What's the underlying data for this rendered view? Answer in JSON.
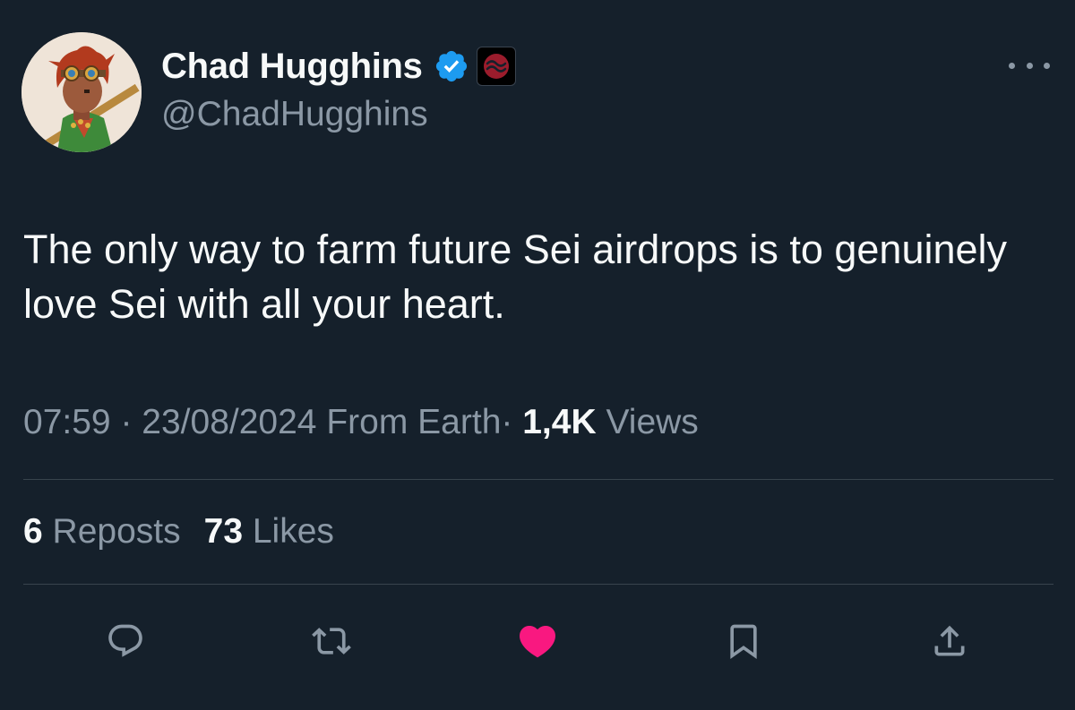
{
  "user": {
    "display_name": "Chad Hugghins",
    "handle": "@ChadHugghins",
    "verified": true
  },
  "tweet": {
    "text": "The only way to farm future Sei airdrops is to genuinely love Sei with all your heart.",
    "time": "07:59",
    "separator": "·",
    "date": "23/08/2024",
    "source": "From Earth",
    "views_count": "1,4K",
    "views_label": "Views"
  },
  "stats": {
    "reposts_count": "6",
    "reposts_label": "Reposts",
    "likes_count": "73",
    "likes_label": "Likes"
  },
  "actions": [
    {
      "icon": "reply-icon",
      "active": false
    },
    {
      "icon": "repost-icon",
      "active": false
    },
    {
      "icon": "heart-icon",
      "active": true
    },
    {
      "icon": "bookmark-icon",
      "active": false
    },
    {
      "icon": "share-icon",
      "active": false
    }
  ],
  "colors": {
    "background": "#15202b",
    "text_primary": "#f7f9f9",
    "text_secondary": "#8b98a5",
    "divider": "#38444d",
    "verified_blue": "#1d9bf0",
    "like_pink": "#f91880",
    "affiliate_red": "#9b1c2c"
  }
}
